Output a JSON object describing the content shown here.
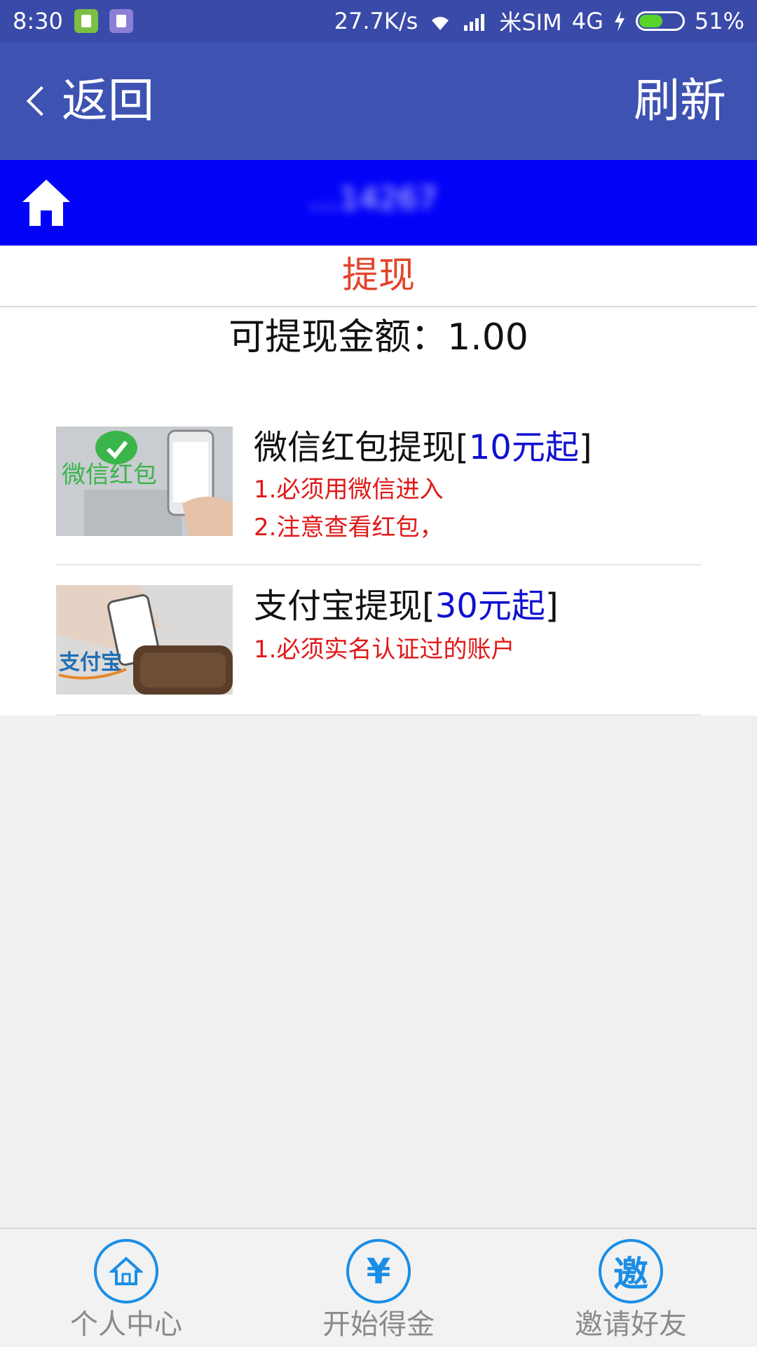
{
  "status_bar": {
    "time": "8:30",
    "network_speed": "27.7K/s",
    "carrier": "米SIM",
    "network_type": "4G",
    "battery_percent": "51%",
    "battery_level": 0.51
  },
  "appbar": {
    "back_label": "返回",
    "refresh_label": "刷新"
  },
  "header": {
    "account_masked": "…14267"
  },
  "withdraw": {
    "tab_title": "提现",
    "balance_text": "可提现金额：1.00",
    "methods": [
      {
        "title": "微信红包提现[",
        "min_amount": "10元起",
        "title_suffix": "]",
        "thumb_text": "微信红包",
        "notes": [
          "1.必须用微信进入",
          "2.注意查看红包，"
        ]
      },
      {
        "title": "支付宝提现[",
        "min_amount": "30元起",
        "title_suffix": "]",
        "thumb_text": "支付宝",
        "notes": [
          "1.必须实名认证过的账户"
        ]
      }
    ]
  },
  "bottom_nav": {
    "items": [
      {
        "label": "个人中心",
        "icon": "home-circle-icon"
      },
      {
        "label": "开始得金",
        "icon": "yuan-circle-icon",
        "glyph": "¥"
      },
      {
        "label": "邀请好友",
        "icon": "invite-circle-icon",
        "glyph": "邀"
      }
    ]
  },
  "colors": {
    "status_bar": "#3a4aa8",
    "appbar": "#3e52b2",
    "header_blue": "#0202f7",
    "title_red": "#e2442a",
    "note_red": "#e01818",
    "amount_blue": "#1010d0",
    "nav_blue": "#1a8ee6"
  }
}
